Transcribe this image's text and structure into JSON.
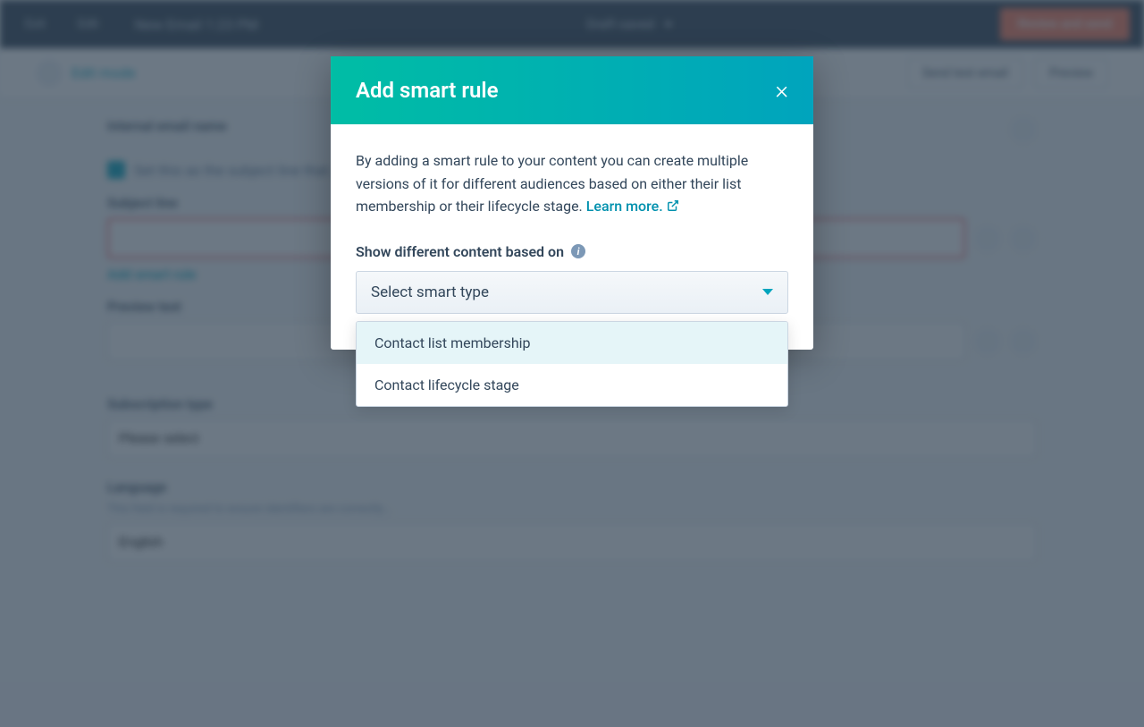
{
  "topBar": {
    "back": "Exit",
    "tab": "Edit",
    "fileTitle": "New Email 1:23 PM",
    "centerLabel": "Draft saved",
    "primaryButton": "Review and send"
  },
  "subBar": {
    "leftLabel": "Edit mode",
    "action1": "Send test email",
    "action2": "Preview"
  },
  "bg": {
    "internalName": "Internal email name",
    "checkboxLabel": "Set this as the subject line that...",
    "subjectLabel": "Subject line",
    "addSmartRule": "Add smart rule",
    "previewLabel": "Preview text",
    "subscriptionLabel": "Subscription type",
    "subscriptionValue": "Please select",
    "languageLabel": "Language",
    "languageHelp": "This field is required to ensure identifiers are correctly...",
    "languageValue": "English"
  },
  "modal": {
    "title": "Add smart rule",
    "description": "By adding a smart rule to your content you can create multiple versions of it for different audiences based on either their list membership or their lifecycle stage. ",
    "learnMore": "Learn more.",
    "fieldLabel": "Show different content based on",
    "selectPlaceholder": "Select smart type",
    "options": [
      "Contact list membership",
      "Contact lifecycle stage"
    ]
  }
}
